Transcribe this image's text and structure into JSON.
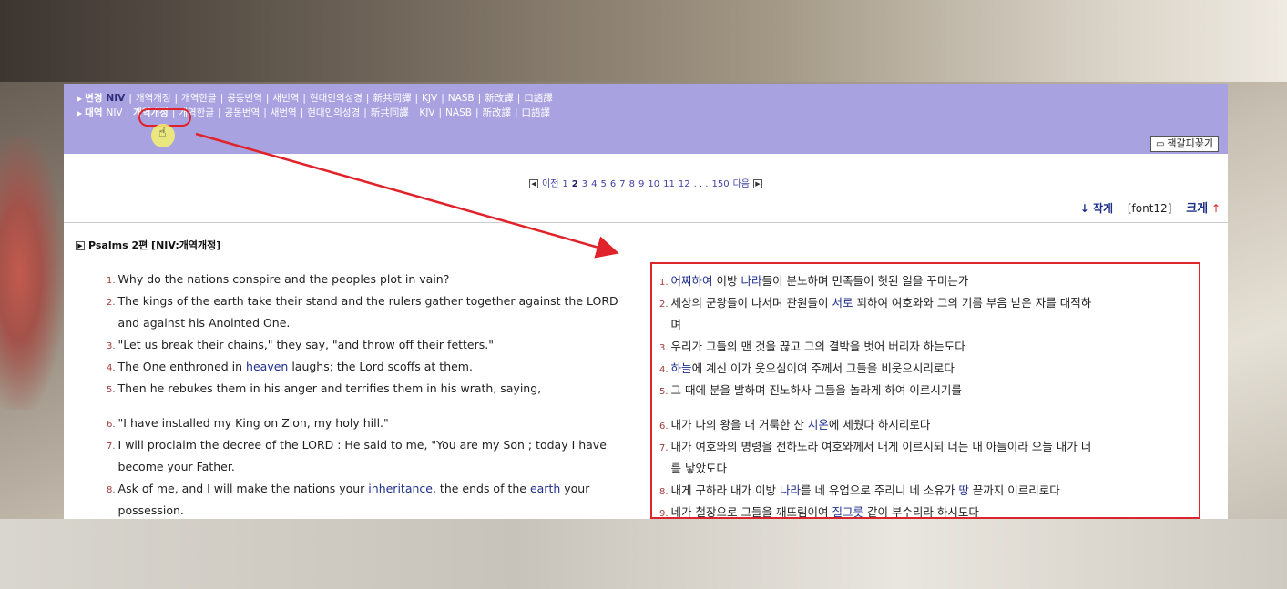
{
  "nav": {
    "rows": [
      {
        "head": "변경",
        "items": [
          "NIV",
          "개역개정",
          "개역한글",
          "공동번역",
          "새번역",
          "현대인의성경",
          "新共同譯",
          "KJV",
          "NASB",
          "新改譯",
          "口語譯"
        ]
      },
      {
        "head": "대역",
        "items": [
          "NIV",
          "개역개정",
          "개역한글",
          "공동번역",
          "새번역",
          "현대인의성경",
          "新共同譯",
          "KJV",
          "NASB",
          "新改譯",
          "口語譯"
        ]
      }
    ],
    "bookmark_label": "책갈피꽂기"
  },
  "pager": {
    "prev": "이전",
    "pages": [
      "1",
      "2",
      "3",
      "4",
      "5",
      "6",
      "7",
      "8",
      "9",
      "10",
      "11",
      "12"
    ],
    "current": "2",
    "ellipsis": ". . .",
    "last": "150",
    "next": "다음"
  },
  "fontbar": {
    "small": "작게",
    "current": "[font12]",
    "big": "크게"
  },
  "chapter_title": "Psalms 2편 [NIV:개역개정]",
  "left_verses": [
    {
      "num": "1.",
      "parts": [
        {
          "t": "Why do the nations conspire and the peoples plot in vain?"
        }
      ]
    },
    {
      "num": "2.",
      "parts": [
        {
          "t": "The kings of the earth take their stand and the rulers gather together against the LORD"
        }
      ]
    },
    {
      "num": "",
      "parts": [
        {
          "t": "and against his Anointed One."
        }
      ]
    },
    {
      "num": "3.",
      "parts": [
        {
          "t": "\"Let us break their chains,\" they say, \"and throw off their fetters.\""
        }
      ]
    },
    {
      "num": "4.",
      "parts": [
        {
          "t": "The One enthroned in "
        },
        {
          "t": "heaven",
          "w": true
        },
        {
          "t": " laughs; the Lord scoffs at them."
        }
      ]
    },
    {
      "num": "5.",
      "parts": [
        {
          "t": "Then he rebukes them in his anger and terrifies them in his wrath, saying,"
        }
      ]
    },
    {
      "gap": true
    },
    {
      "num": "6.",
      "parts": [
        {
          "t": "\"I have installed my King on Zion, my holy hill.\""
        }
      ]
    },
    {
      "num": "7.",
      "parts": [
        {
          "t": "I will proclaim the decree of the LORD : He said to me, \"You are my Son ; today I have"
        }
      ]
    },
    {
      "num": "",
      "parts": [
        {
          "t": "become your Father."
        }
      ]
    },
    {
      "num": "8.",
      "parts": [
        {
          "t": "Ask of me, and I will make the nations your "
        },
        {
          "t": "inheritance",
          "w": true
        },
        {
          "t": ", the ends of the "
        },
        {
          "t": "earth",
          "w": true
        },
        {
          "t": " your"
        }
      ]
    },
    {
      "num": "",
      "parts": [
        {
          "t": "possession."
        }
      ]
    }
  ],
  "right_verses": [
    {
      "num": "1.",
      "parts": [
        {
          "t": "어찌하여",
          "w": true
        },
        {
          "t": " 이방 "
        },
        {
          "t": "나라",
          "w": true
        },
        {
          "t": "들이 분노하며 민족들이 헛된 일을 꾸미는가"
        }
      ]
    },
    {
      "num": "2.",
      "parts": [
        {
          "t": "세상의 군왕들이 나서며 관원들이 "
        },
        {
          "t": "서로",
          "w": true
        },
        {
          "t": " 꾀하여 여호와와 그의 기름 부음 받은 자를 대적하"
        }
      ]
    },
    {
      "num": "",
      "parts": [
        {
          "t": "며"
        }
      ]
    },
    {
      "num": "3.",
      "parts": [
        {
          "t": "우리가 그들의 맨 것을 끊고 그의 결박을 벗어 버리자 하는도다"
        }
      ]
    },
    {
      "num": "4.",
      "parts": [
        {
          "t": "하늘",
          "w": true
        },
        {
          "t": "에 계신 이가 웃으심이여 주께서 그들을 비웃으시리로다"
        }
      ]
    },
    {
      "num": "5.",
      "parts": [
        {
          "t": "그 때에 분을 발하며 진노하사 그들을 놀라게 하여 이르시기를"
        }
      ]
    },
    {
      "gap": true
    },
    {
      "num": "6.",
      "parts": [
        {
          "t": "내가 나의 왕을 내 거룩한 산 "
        },
        {
          "t": "시온",
          "w": true
        },
        {
          "t": "에 세웠다 하시리로다"
        }
      ]
    },
    {
      "num": "7.",
      "parts": [
        {
          "t": "내가 여호와의 명령을 전하노라 여호와께서 내게 이르시되 너는 내 아들이라 오늘 내가 너"
        }
      ]
    },
    {
      "num": "",
      "parts": [
        {
          "t": "를 낳았도다"
        }
      ]
    },
    {
      "num": "8.",
      "parts": [
        {
          "t": "내게 구하라 내가 이방 "
        },
        {
          "t": "나라",
          "w": true
        },
        {
          "t": "를 네 유업으로 주리니 네 소유가 "
        },
        {
          "t": "땅",
          "w": true
        },
        {
          "t": " 끝까지 이르리로다"
        }
      ]
    },
    {
      "num": "9.",
      "parts": [
        {
          "t": "네가 철장으로 그들을 깨뜨림이여 "
        },
        {
          "t": "질그릇",
          "w": true
        },
        {
          "t": " 같이 부수리라 하시도다"
        }
      ]
    }
  ],
  "colors": {
    "nav_bg": "#a8a3e0",
    "annotation_red": "#e0232b",
    "verse_link": "#1f2f8c"
  }
}
